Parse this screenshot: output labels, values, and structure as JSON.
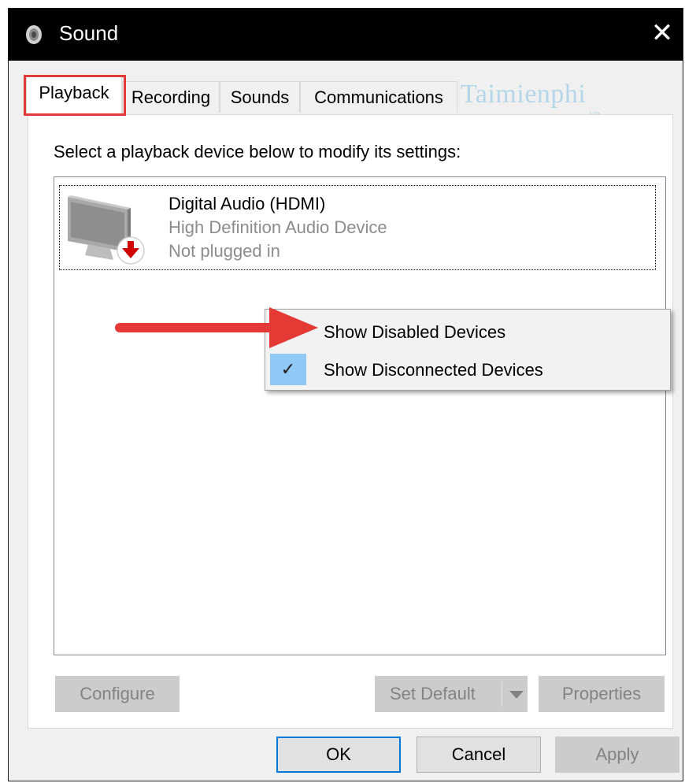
{
  "window": {
    "title": "Sound",
    "close_glyph": "✕"
  },
  "tabs": [
    {
      "label": "Playback",
      "active": true
    },
    {
      "label": "Recording",
      "active": false
    },
    {
      "label": "Sounds",
      "active": false
    },
    {
      "label": "Communications",
      "active": false
    }
  ],
  "watermark": {
    "text": "Taimienphi",
    "sub": ".vn"
  },
  "instructions": "Select a playback device below to modify its settings:",
  "devices": [
    {
      "name": "Digital Audio (HDMI)",
      "description": "High Definition Audio Device",
      "status": "Not plugged in",
      "icon": "monitor-speaker-icon",
      "badge_icon": "down-arrow-badge-icon"
    }
  ],
  "context_menu": {
    "items": [
      {
        "label": "Show Disabled Devices",
        "checked": false
      },
      {
        "label": "Show Disconnected Devices",
        "checked": true
      }
    ],
    "check_glyph": "✓"
  },
  "panel_buttons": {
    "configure": "Configure",
    "set_default": "Set Default",
    "properties": "Properties"
  },
  "footer_buttons": {
    "ok": "OK",
    "cancel": "Cancel",
    "apply": "Apply"
  },
  "colors": {
    "highlight_red": "#e03a3a",
    "check_blue": "#90c8f6",
    "default_button_border": "#0078d7",
    "titlebar": "#000000"
  }
}
